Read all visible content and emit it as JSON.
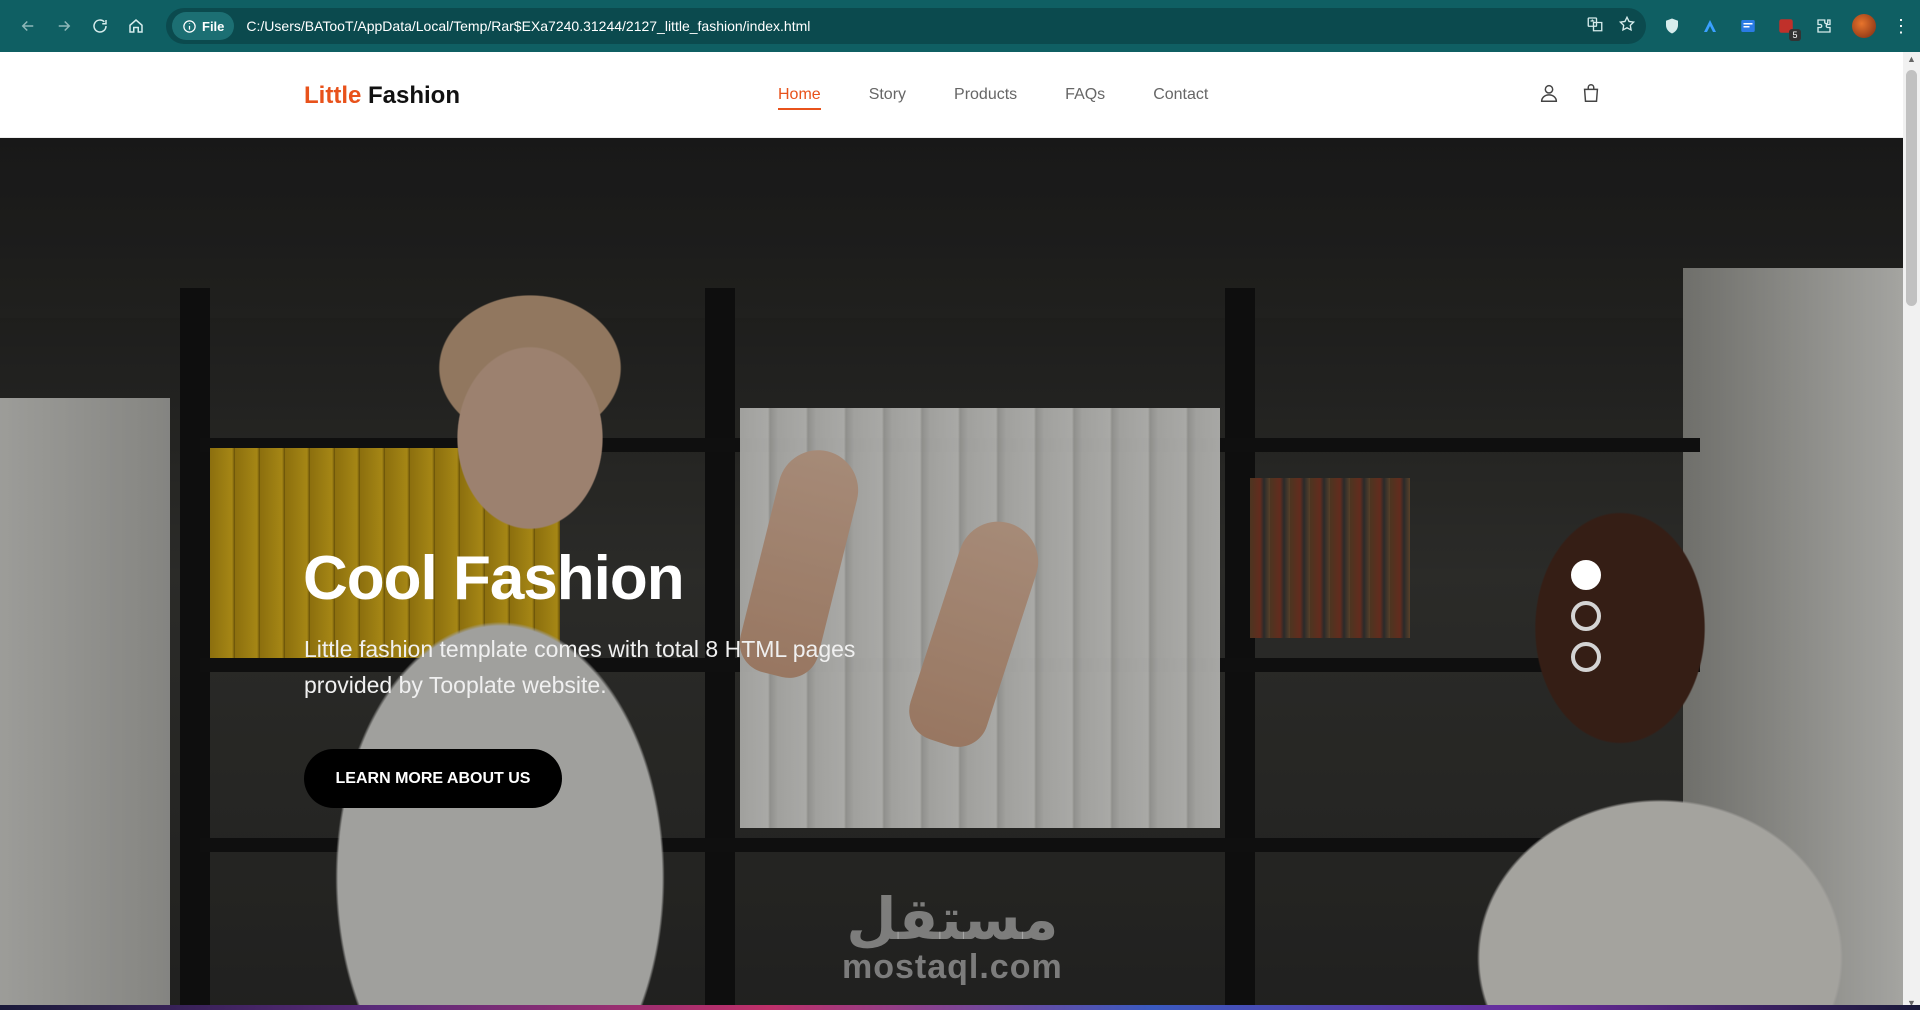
{
  "browser": {
    "site_chip": "File",
    "url": "C:/Users/BATooT/AppData/Local/Temp/Rar$EXa7240.31244/2127_little_fashion/index.html",
    "extension_badge": "5"
  },
  "header": {
    "brand_accent": "Little",
    "brand_rest": "Fashion",
    "nav": [
      "Home",
      "Story",
      "Products",
      "FAQs",
      "Contact"
    ],
    "active_nav": "Home"
  },
  "hero": {
    "title": "Cool Fashion",
    "text": "Little fashion template comes with total 8 HTML pages provided by Tooplate website.",
    "cta": "LEARN MORE ABOUT US",
    "slides": 3,
    "active_slide": 1
  },
  "watermark": {
    "arabic": "مستقل",
    "latin": "mostaql.com"
  },
  "colors": {
    "chrome": "#0f5f63",
    "accent": "#e8521b",
    "cta": "#000000"
  }
}
